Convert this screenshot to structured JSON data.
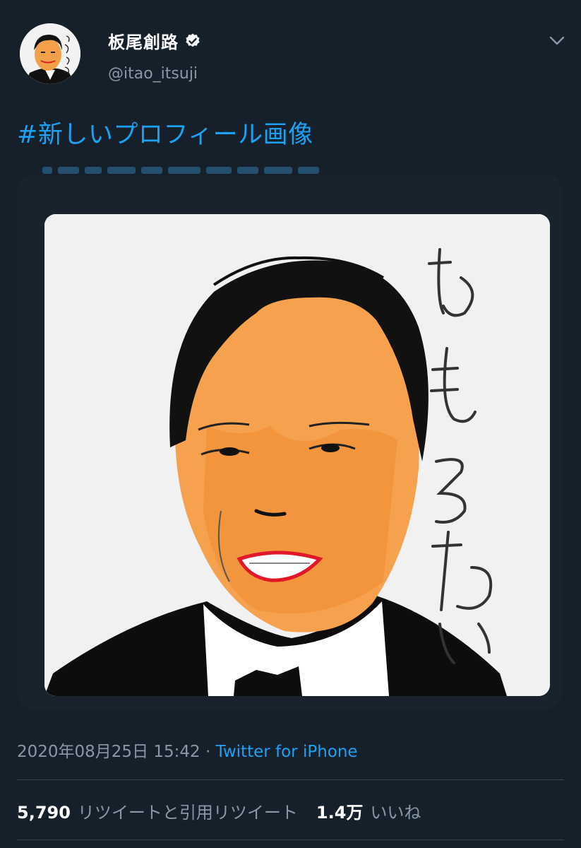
{
  "author": {
    "display_name": "板尾創路",
    "handle": "@itao_itsuji",
    "verified": true,
    "avatar_icon": "profile-portrait-icon"
  },
  "tweet": {
    "text": "#新しいプロフィール画像",
    "media": {
      "icon": "hand-drawn-portrait",
      "drawn_text": "おもろない"
    },
    "timestamp": "2020年08月25日 15:42",
    "separator": " · ",
    "source": "Twitter for iPhone"
  },
  "stats": {
    "retweets_count": "5,790",
    "retweets_label": "リツイートと引用リツイート",
    "likes_count": "1.4万",
    "likes_label": "いいね"
  },
  "colors": {
    "background": "#15202b",
    "accent": "#1da1f2",
    "secondary_text": "#8899a6",
    "divider": "#38444d"
  }
}
